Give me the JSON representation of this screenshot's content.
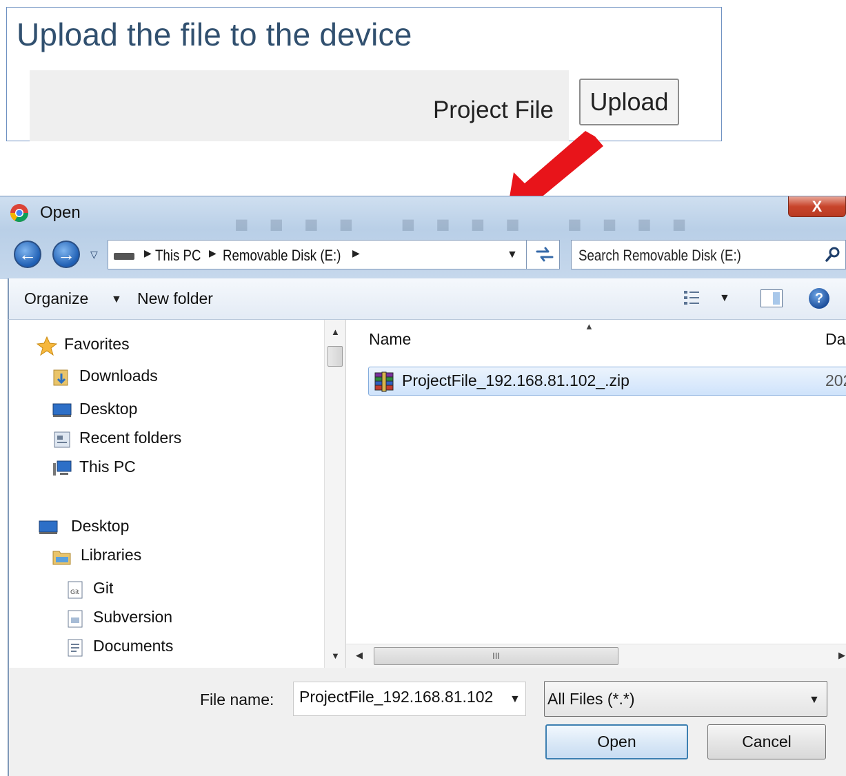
{
  "upload_panel": {
    "title": "Upload the file to the device",
    "label": "Project File",
    "upload_button": "Upload"
  },
  "dialog": {
    "title": "Open",
    "close_glyph": "X",
    "breadcrumbs": [
      "This PC",
      "Removable Disk (E:)"
    ],
    "search_placeholder": "Search Removable Disk (E:)",
    "toolbar": {
      "organize": "Organize",
      "new_folder": "New folder",
      "help_glyph": "?"
    },
    "nav": {
      "favorites": "Favorites",
      "downloads": "Downloads",
      "desktop_fav": "Desktop",
      "recent_folders": "Recent folders",
      "this_pc": "This PC",
      "desktop": "Desktop",
      "libraries": "Libraries",
      "git": "Git",
      "subversion": "Subversion",
      "documents": "Documents"
    },
    "columns": {
      "name": "Name",
      "date": "Da"
    },
    "files": [
      {
        "name": "ProjectFile_192.168.81.102_.zip",
        "date": "202"
      }
    ],
    "footer": {
      "file_name_label": "File name:",
      "file_name_value": "ProjectFile_192.168.81.102",
      "filter": "All Files (*.*)",
      "open": "Open",
      "cancel": "Cancel"
    },
    "h_scroll_grip": "III"
  },
  "colors": {
    "accent_arrow": "#e8141a",
    "title_text": "#31506f",
    "selection": "#cfe3fb"
  }
}
